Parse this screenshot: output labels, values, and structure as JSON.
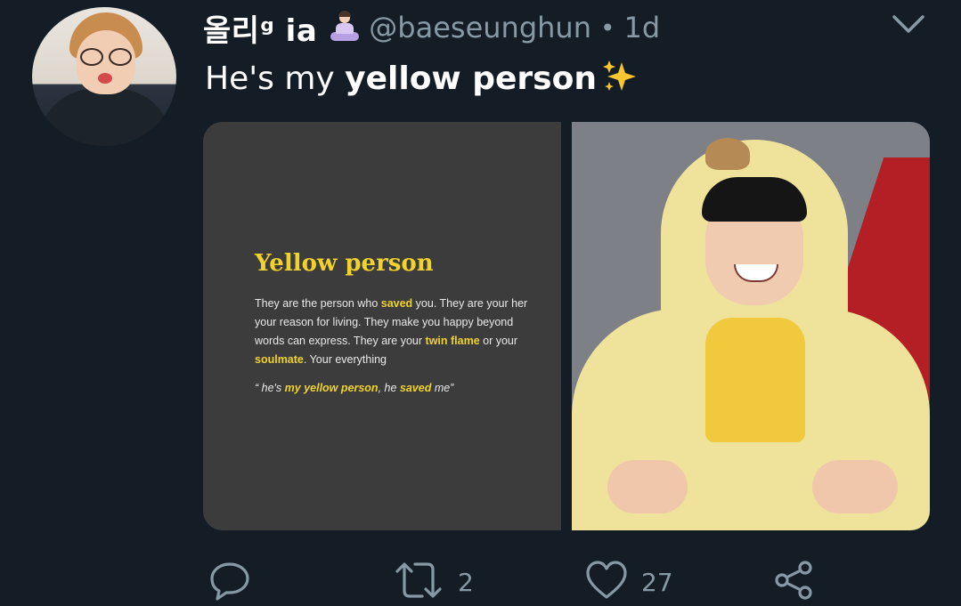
{
  "tweet": {
    "display_name": "올리ᵍ ia",
    "name_emoji": "person-in-lotus-position",
    "handle": "@baeseunghun",
    "separator": "•",
    "timestamp": "1d",
    "text_regular": "He's my ",
    "text_bold": "yellow person",
    "text_emoji": "sparkles"
  },
  "media": {
    "card": {
      "title": "Yellow person",
      "body": [
        {
          "t": "They are the person who ",
          "h": false
        },
        {
          "t": "saved",
          "h": true
        },
        {
          "t": " you. They are your her\nyour reason for living. They make you happy beyond\nwords can express. They are your ",
          "h": false
        },
        {
          "t": "twin flame",
          "h": true
        },
        {
          "t": " or your\n",
          "h": false
        },
        {
          "t": "soulmate",
          "h": true
        },
        {
          "t": ". Your everything",
          "h": false
        }
      ],
      "quote": [
        {
          "t": "“  he's ",
          "h": false
        },
        {
          "t": "my yellow person",
          "h": true
        },
        {
          "t": ",   he ",
          "h": false
        },
        {
          "t": "saved",
          "h": true
        },
        {
          "t": " me”",
          "h": false
        }
      ]
    },
    "photo": {}
  },
  "actions": {
    "reply_count": "",
    "retweet_count": "2",
    "like_count": "27",
    "share_count": ""
  },
  "colors": {
    "background": "#141d26",
    "muted": "#8899a6",
    "text": "#ffffff",
    "highlight_yellow": "#f0d22a"
  }
}
